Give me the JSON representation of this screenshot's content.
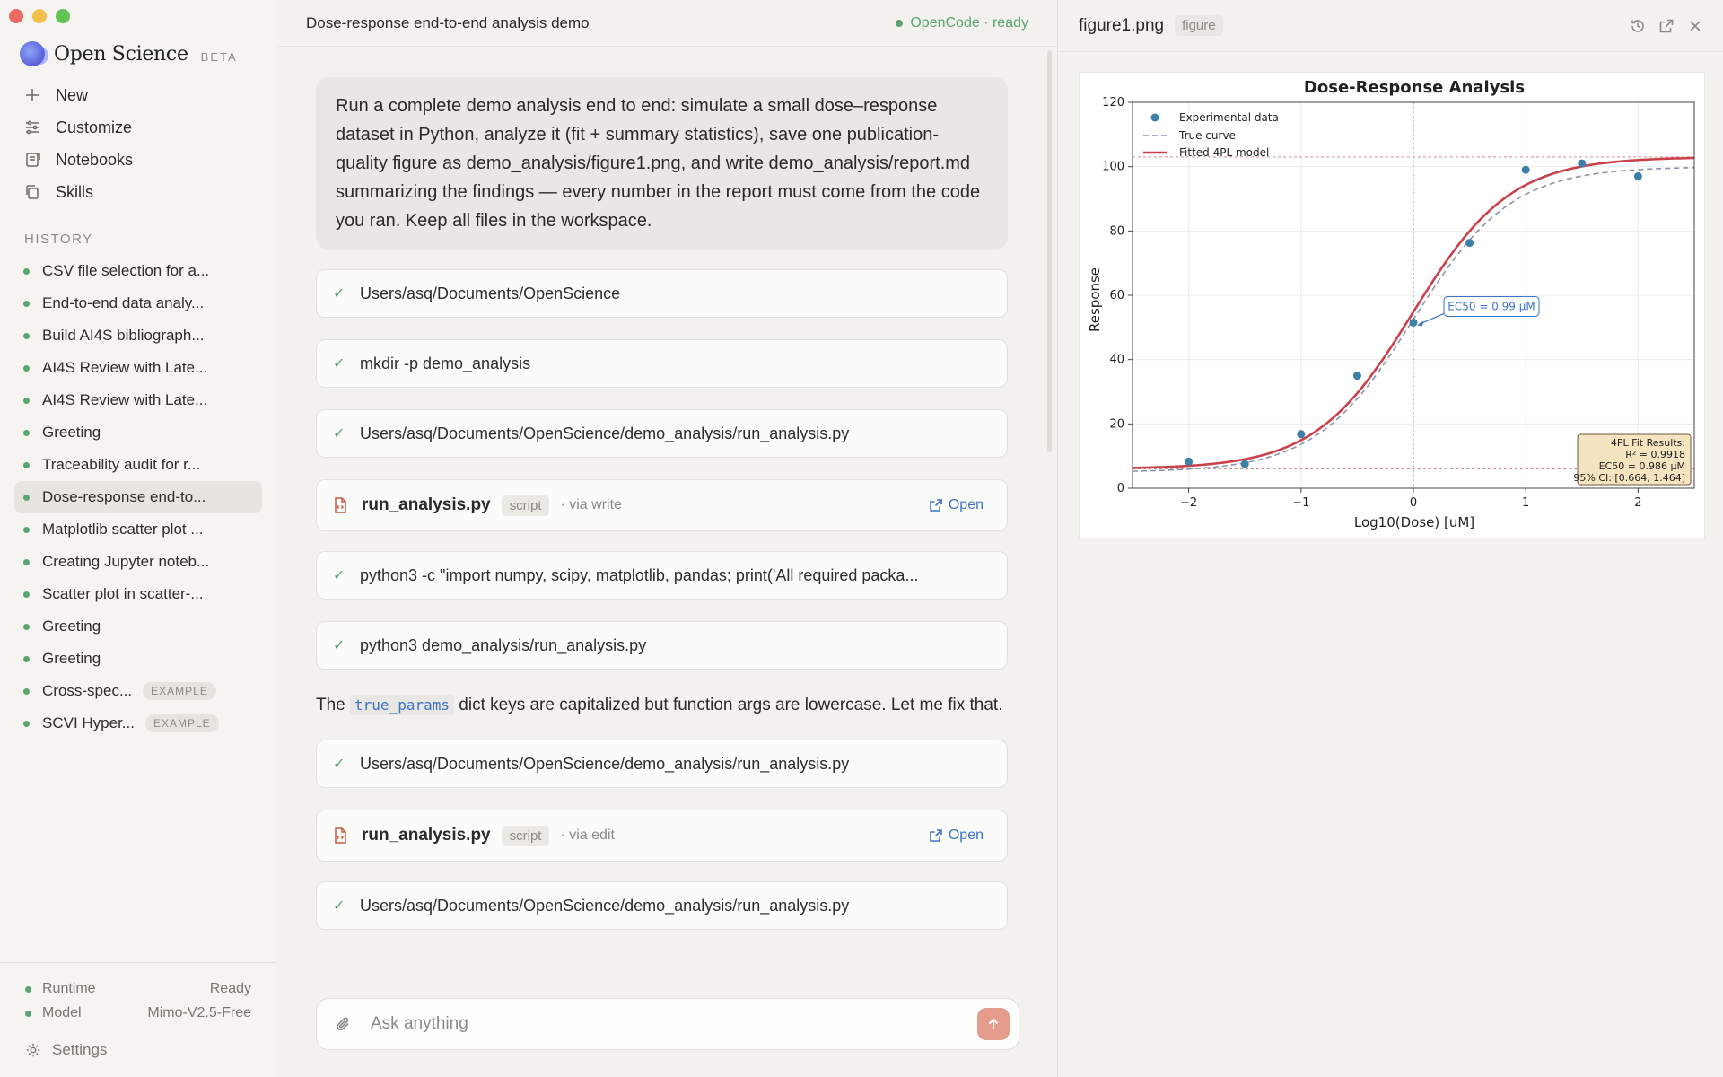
{
  "window": {
    "traffic_colors": [
      "#ec6a5f",
      "#f4bf4f",
      "#61c554"
    ]
  },
  "sidebar": {
    "brand": "Open Science",
    "beta": "BETA",
    "nav": [
      {
        "label": "New",
        "icon": "plus-icon"
      },
      {
        "label": "Customize",
        "icon": "sliders-icon"
      },
      {
        "label": "Notebooks",
        "icon": "notebook-icon"
      },
      {
        "label": "Skills",
        "icon": "copy-icon"
      }
    ],
    "history_title": "HISTORY",
    "history": [
      {
        "label": "CSV file selection for a...",
        "badge": ""
      },
      {
        "label": "End-to-end data analy...",
        "badge": ""
      },
      {
        "label": "Build AI4S bibliograph...",
        "badge": ""
      },
      {
        "label": "AI4S Review with Late...",
        "badge": ""
      },
      {
        "label": "AI4S Review with Late...",
        "badge": ""
      },
      {
        "label": "Greeting",
        "badge": ""
      },
      {
        "label": "Traceability audit for r...",
        "badge": ""
      },
      {
        "label": "Dose-response end-to...",
        "badge": "",
        "active": true
      },
      {
        "label": "Matplotlib scatter plot ...",
        "badge": ""
      },
      {
        "label": "Creating Jupyter noteb...",
        "badge": ""
      },
      {
        "label": "Scatter plot in scatter-...",
        "badge": ""
      },
      {
        "label": "Greeting",
        "badge": ""
      },
      {
        "label": "Greeting",
        "badge": ""
      },
      {
        "label": "Cross-spec...",
        "badge": "EXAMPLE"
      },
      {
        "label": "SCVI Hyper...",
        "badge": "EXAMPLE"
      }
    ],
    "footer": {
      "runtime_label": "Runtime",
      "runtime_value": "Ready",
      "model_label": "Model",
      "model_value": "Mimo-V2.5-Free",
      "settings_label": "Settings"
    }
  },
  "main": {
    "title": "Dose-response end-to-end analysis demo",
    "status": "OpenCode · ready",
    "user_message": "Run a complete demo analysis end to end: simulate a small dose–response dataset in Python, analyze it (fit + summary statistics), save one publication-quality figure as demo_analysis/figure1.png, and write demo_analysis/report.md summarizing the findings — every number in the report must come from the code you ran. Keep all files in the workspace.",
    "steps": {
      "s1": "Users/asq/Documents/OpenScience",
      "s2": "mkdir -p demo_analysis",
      "s3": "Users/asq/Documents/OpenScience/demo_analysis/run_analysis.py",
      "f1_name": "run_analysis.py",
      "f1_tag": "script",
      "f1_via": "· via write",
      "s4": "python3 -c \"import numpy, scipy, matplotlib, pandas; print('All required packa...",
      "s5": "python3 demo_analysis/run_analysis.py",
      "s6": "Users/asq/Documents/OpenScience/demo_analysis/run_analysis.py",
      "f2_name": "run_analysis.py",
      "f2_tag": "script",
      "f2_via": "· via edit",
      "s7": "Users/asq/Documents/OpenScience/demo_analysis/run_analysis.py",
      "open_label": "Open"
    },
    "assistant": {
      "pre": "The ",
      "code": "true_params",
      "post": " dict keys are capitalized but function args are lowercase. Let me fix that."
    },
    "composer_placeholder": "Ask anything",
    "accent": "#5aa471",
    "link_color": "#3b73c5"
  },
  "panel": {
    "filename": "figure1.png",
    "tag": "figure"
  },
  "chart_data": {
    "type": "scatter",
    "title": "Dose-Response Analysis",
    "xlabel": "Log10(Dose) [uM]",
    "ylabel": "Response",
    "xlim": [
      -2.5,
      2.5
    ],
    "ylim": [
      0,
      120
    ],
    "xticks": [
      -2,
      -1,
      0,
      1,
      2
    ],
    "xtick_labels": [
      "−2",
      "−1",
      "0",
      "1",
      "2"
    ],
    "yticks": [
      0,
      20,
      40,
      60,
      80,
      100,
      120
    ],
    "grid": true,
    "legend_position": "top-left",
    "series": [
      {
        "name": "Experimental data",
        "kind": "scatter",
        "color": "#3c7fa8",
        "x": [
          -2.0,
          -1.5,
          -1.0,
          -0.5,
          0.0,
          0.5,
          1.0,
          1.5,
          2.0
        ],
        "y": [
          8.3,
          7.5,
          16.8,
          35.0,
          51.5,
          76.3,
          99.0,
          101.0,
          97.0
        ]
      },
      {
        "name": "True curve",
        "kind": "line",
        "style": "dashed",
        "color": "#8a93a8",
        "params": {
          "bottom": 5,
          "top": 100,
          "ec50_log": 0,
          "hill": 1.0
        }
      },
      {
        "name": "Fitted 4PL model",
        "kind": "line",
        "color": "#c9414a",
        "params": {
          "bottom": 6,
          "top": 103,
          "ec50_log": -0.006,
          "hill": 1.0
        }
      }
    ],
    "reference_lines": {
      "vertical_x": 0,
      "horizontal_y": [
        103,
        6
      ]
    },
    "annotation": {
      "text": "EC50 = 0.99 μM",
      "x": 0.0,
      "y": 51.5
    },
    "results_box": [
      "4PL Fit Results:",
      "R² = 0.9918",
      "EC50 = 0.986 μM",
      "95% CI: [0.664, 1.464]"
    ]
  }
}
